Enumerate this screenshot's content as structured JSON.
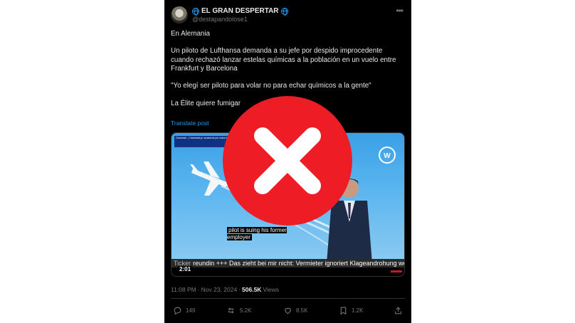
{
  "author": {
    "display_name": "EL GRAN DESPERTAR",
    "handle": "@destapandolose1"
  },
  "post": {
    "paragraphs": [
      "En Alemania",
      "Un piloto de Lufthansa demanda a su jefe por despido improcedente cuando rechazó lanzar estelas químicas a la población en un vuelo entre Frankfurt y Barcelona",
      "\"Yo elegí ser piloto para volar no  para echar químicos a la gente\"",
      "La Élite quiere fumigar"
    ],
    "translate_label": "Translate post"
  },
  "media": {
    "overlay_text": "Chemtrail – Chemtrails je označenie pre súbor konšpiračných teórií podľa ktorých",
    "captions": "pilot is suing his former employer",
    "ticker_label": "Ticker",
    "ticker_text": "reundin +++ Das zieht bei mir nicht: Vermieter ignoriert Klageandrohung wegen u",
    "duration": "2:01"
  },
  "meta": {
    "time": "11:08 PM",
    "separator": "·",
    "date": "Nov 23, 2024",
    "views_count": "506.5K",
    "views_label": "Views"
  },
  "actions": {
    "replies": "149",
    "reposts": "5.2K",
    "likes": "8.5K",
    "bookmarks": "1.2K"
  },
  "overlay": {
    "icon": "red-x-icon",
    "circle_color": "#ee1c25",
    "cross_color": "#ffffff"
  }
}
